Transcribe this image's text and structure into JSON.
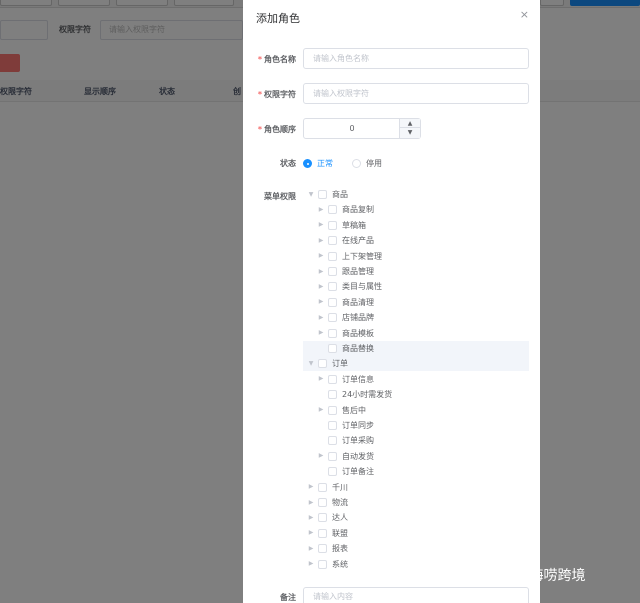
{
  "background": {
    "labels": {
      "permission": "权限字符"
    },
    "placeholders": {
      "permission": "请输入权限字符"
    },
    "table_headers": [
      "权限字符",
      "显示顺序",
      "状态",
      "创"
    ]
  },
  "dialog": {
    "title": "添加角色",
    "close_icon": "×",
    "fields": {
      "role_name": {
        "label": "角色名称",
        "required": "*",
        "placeholder": "请输入角色名称"
      },
      "permission": {
        "label": "权限字符",
        "required": "*",
        "placeholder": "请输入权限字符"
      },
      "order": {
        "label": "角色顺序",
        "required": "*",
        "value": "0",
        "up_icon": "▲",
        "down_icon": "▼"
      },
      "status": {
        "label": "状态",
        "options": [
          "正常",
          "停用"
        ],
        "selected": "正常"
      },
      "menu": {
        "label": "菜单权限"
      },
      "remark": {
        "label": "备注",
        "placeholder": "请输入内容"
      }
    },
    "tree": [
      {
        "label": "商品",
        "level": 0,
        "arrow": "expanded"
      },
      {
        "label": "商品复制",
        "level": 1,
        "arrow": "collapsed"
      },
      {
        "label": "草稿箱",
        "level": 1,
        "arrow": "collapsed"
      },
      {
        "label": "在线产品",
        "level": 1,
        "arrow": "collapsed"
      },
      {
        "label": "上下架管理",
        "level": 1,
        "arrow": "collapsed"
      },
      {
        "label": "跟品管理",
        "level": 1,
        "arrow": "collapsed"
      },
      {
        "label": "类目与属性",
        "level": 1,
        "arrow": "collapsed"
      },
      {
        "label": "商品清理",
        "level": 1,
        "arrow": "collapsed"
      },
      {
        "label": "店铺品牌",
        "level": 1,
        "arrow": "collapsed"
      },
      {
        "label": "商品模板",
        "level": 1,
        "arrow": "collapsed"
      },
      {
        "label": "商品替换",
        "level": 1,
        "arrow": "none",
        "highlight": true
      },
      {
        "label": "订单",
        "level": 0,
        "arrow": "expanded",
        "highlight": true
      },
      {
        "label": "订单信息",
        "level": 1,
        "arrow": "collapsed"
      },
      {
        "label": "24小时需发货",
        "level": 1,
        "arrow": "none"
      },
      {
        "label": "售后中",
        "level": 1,
        "arrow": "collapsed"
      },
      {
        "label": "订单同步",
        "level": 1,
        "arrow": "none"
      },
      {
        "label": "订单采购",
        "level": 1,
        "arrow": "none"
      },
      {
        "label": "自动发货",
        "level": 1,
        "arrow": "collapsed"
      },
      {
        "label": "订单备注",
        "level": 1,
        "arrow": "none"
      },
      {
        "label": "千川",
        "level": 0,
        "arrow": "collapsed"
      },
      {
        "label": "物流",
        "level": 0,
        "arrow": "collapsed"
      },
      {
        "label": "达人",
        "level": 0,
        "arrow": "collapsed"
      },
      {
        "label": "联盟",
        "level": 0,
        "arrow": "collapsed"
      },
      {
        "label": "报表",
        "level": 0,
        "arrow": "collapsed"
      },
      {
        "label": "系统",
        "level": 0,
        "arrow": "collapsed"
      }
    ]
  },
  "watermark": "知乎 @小海唠跨境",
  "colors": {
    "primary": "#1890ff",
    "danger": "#f56c6c",
    "mask": "rgba(0,0,0,0.5)"
  }
}
